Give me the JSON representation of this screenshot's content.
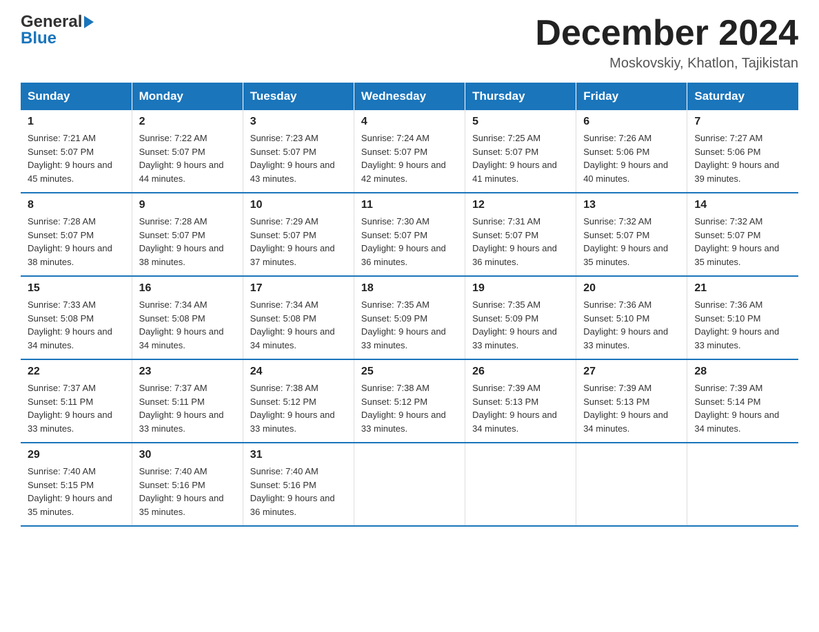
{
  "header": {
    "logo_line1": "General",
    "logo_line2": "Blue",
    "month_title": "December 2024",
    "location": "Moskovskiy, Khatlon, Tajikistan"
  },
  "days_of_week": [
    "Sunday",
    "Monday",
    "Tuesday",
    "Wednesday",
    "Thursday",
    "Friday",
    "Saturday"
  ],
  "weeks": [
    [
      {
        "day": "1",
        "sunrise": "Sunrise: 7:21 AM",
        "sunset": "Sunset: 5:07 PM",
        "daylight": "Daylight: 9 hours and 45 minutes."
      },
      {
        "day": "2",
        "sunrise": "Sunrise: 7:22 AM",
        "sunset": "Sunset: 5:07 PM",
        "daylight": "Daylight: 9 hours and 44 minutes."
      },
      {
        "day": "3",
        "sunrise": "Sunrise: 7:23 AM",
        "sunset": "Sunset: 5:07 PM",
        "daylight": "Daylight: 9 hours and 43 minutes."
      },
      {
        "day": "4",
        "sunrise": "Sunrise: 7:24 AM",
        "sunset": "Sunset: 5:07 PM",
        "daylight": "Daylight: 9 hours and 42 minutes."
      },
      {
        "day": "5",
        "sunrise": "Sunrise: 7:25 AM",
        "sunset": "Sunset: 5:07 PM",
        "daylight": "Daylight: 9 hours and 41 minutes."
      },
      {
        "day": "6",
        "sunrise": "Sunrise: 7:26 AM",
        "sunset": "Sunset: 5:06 PM",
        "daylight": "Daylight: 9 hours and 40 minutes."
      },
      {
        "day": "7",
        "sunrise": "Sunrise: 7:27 AM",
        "sunset": "Sunset: 5:06 PM",
        "daylight": "Daylight: 9 hours and 39 minutes."
      }
    ],
    [
      {
        "day": "8",
        "sunrise": "Sunrise: 7:28 AM",
        "sunset": "Sunset: 5:07 PM",
        "daylight": "Daylight: 9 hours and 38 minutes."
      },
      {
        "day": "9",
        "sunrise": "Sunrise: 7:28 AM",
        "sunset": "Sunset: 5:07 PM",
        "daylight": "Daylight: 9 hours and 38 minutes."
      },
      {
        "day": "10",
        "sunrise": "Sunrise: 7:29 AM",
        "sunset": "Sunset: 5:07 PM",
        "daylight": "Daylight: 9 hours and 37 minutes."
      },
      {
        "day": "11",
        "sunrise": "Sunrise: 7:30 AM",
        "sunset": "Sunset: 5:07 PM",
        "daylight": "Daylight: 9 hours and 36 minutes."
      },
      {
        "day": "12",
        "sunrise": "Sunrise: 7:31 AM",
        "sunset": "Sunset: 5:07 PM",
        "daylight": "Daylight: 9 hours and 36 minutes."
      },
      {
        "day": "13",
        "sunrise": "Sunrise: 7:32 AM",
        "sunset": "Sunset: 5:07 PM",
        "daylight": "Daylight: 9 hours and 35 minutes."
      },
      {
        "day": "14",
        "sunrise": "Sunrise: 7:32 AM",
        "sunset": "Sunset: 5:07 PM",
        "daylight": "Daylight: 9 hours and 35 minutes."
      }
    ],
    [
      {
        "day": "15",
        "sunrise": "Sunrise: 7:33 AM",
        "sunset": "Sunset: 5:08 PM",
        "daylight": "Daylight: 9 hours and 34 minutes."
      },
      {
        "day": "16",
        "sunrise": "Sunrise: 7:34 AM",
        "sunset": "Sunset: 5:08 PM",
        "daylight": "Daylight: 9 hours and 34 minutes."
      },
      {
        "day": "17",
        "sunrise": "Sunrise: 7:34 AM",
        "sunset": "Sunset: 5:08 PM",
        "daylight": "Daylight: 9 hours and 34 minutes."
      },
      {
        "day": "18",
        "sunrise": "Sunrise: 7:35 AM",
        "sunset": "Sunset: 5:09 PM",
        "daylight": "Daylight: 9 hours and 33 minutes."
      },
      {
        "day": "19",
        "sunrise": "Sunrise: 7:35 AM",
        "sunset": "Sunset: 5:09 PM",
        "daylight": "Daylight: 9 hours and 33 minutes."
      },
      {
        "day": "20",
        "sunrise": "Sunrise: 7:36 AM",
        "sunset": "Sunset: 5:10 PM",
        "daylight": "Daylight: 9 hours and 33 minutes."
      },
      {
        "day": "21",
        "sunrise": "Sunrise: 7:36 AM",
        "sunset": "Sunset: 5:10 PM",
        "daylight": "Daylight: 9 hours and 33 minutes."
      }
    ],
    [
      {
        "day": "22",
        "sunrise": "Sunrise: 7:37 AM",
        "sunset": "Sunset: 5:11 PM",
        "daylight": "Daylight: 9 hours and 33 minutes."
      },
      {
        "day": "23",
        "sunrise": "Sunrise: 7:37 AM",
        "sunset": "Sunset: 5:11 PM",
        "daylight": "Daylight: 9 hours and 33 minutes."
      },
      {
        "day": "24",
        "sunrise": "Sunrise: 7:38 AM",
        "sunset": "Sunset: 5:12 PM",
        "daylight": "Daylight: 9 hours and 33 minutes."
      },
      {
        "day": "25",
        "sunrise": "Sunrise: 7:38 AM",
        "sunset": "Sunset: 5:12 PM",
        "daylight": "Daylight: 9 hours and 33 minutes."
      },
      {
        "day": "26",
        "sunrise": "Sunrise: 7:39 AM",
        "sunset": "Sunset: 5:13 PM",
        "daylight": "Daylight: 9 hours and 34 minutes."
      },
      {
        "day": "27",
        "sunrise": "Sunrise: 7:39 AM",
        "sunset": "Sunset: 5:13 PM",
        "daylight": "Daylight: 9 hours and 34 minutes."
      },
      {
        "day": "28",
        "sunrise": "Sunrise: 7:39 AM",
        "sunset": "Sunset: 5:14 PM",
        "daylight": "Daylight: 9 hours and 34 minutes."
      }
    ],
    [
      {
        "day": "29",
        "sunrise": "Sunrise: 7:40 AM",
        "sunset": "Sunset: 5:15 PM",
        "daylight": "Daylight: 9 hours and 35 minutes."
      },
      {
        "day": "30",
        "sunrise": "Sunrise: 7:40 AM",
        "sunset": "Sunset: 5:16 PM",
        "daylight": "Daylight: 9 hours and 35 minutes."
      },
      {
        "day": "31",
        "sunrise": "Sunrise: 7:40 AM",
        "sunset": "Sunset: 5:16 PM",
        "daylight": "Daylight: 9 hours and 36 minutes."
      },
      null,
      null,
      null,
      null
    ]
  ]
}
